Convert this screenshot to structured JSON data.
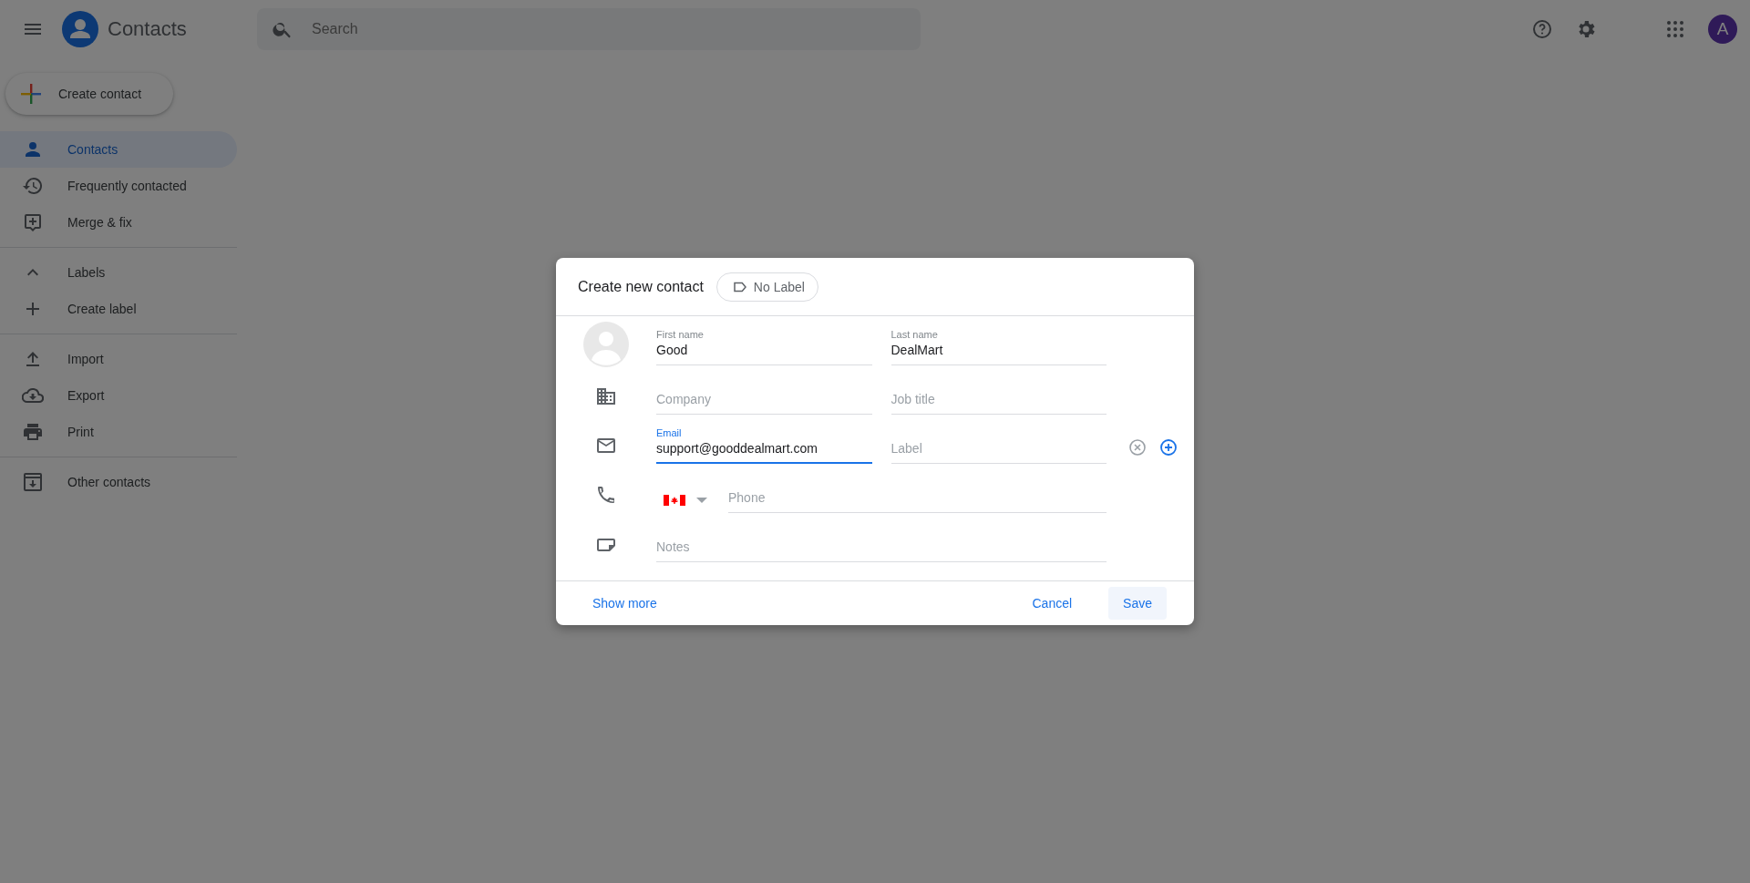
{
  "app": {
    "title": "Contacts"
  },
  "search": {
    "placeholder": "Search"
  },
  "account": {
    "initial": "A"
  },
  "create_button": {
    "label": "Create contact"
  },
  "sidebar": {
    "sections": [
      {
        "items": [
          {
            "label": "Contacts",
            "selected": true
          },
          {
            "label": "Frequently contacted",
            "selected": false
          },
          {
            "label": "Merge & fix",
            "selected": false
          }
        ]
      },
      {
        "header": {
          "label": "Labels",
          "expanded": true
        },
        "items": [
          {
            "label": "Create label",
            "selected": false
          }
        ]
      },
      {
        "items": [
          {
            "label": "Import",
            "selected": false
          },
          {
            "label": "Export",
            "selected": false
          },
          {
            "label": "Print",
            "selected": false
          }
        ]
      },
      {
        "items": [
          {
            "label": "Other contacts",
            "selected": false
          }
        ]
      }
    ]
  },
  "dialog": {
    "title": "Create new contact",
    "label_chip": "No Label",
    "rows": [
      {
        "kind": "avatar",
        "fields": [
          {
            "label": "First name",
            "value": "Good",
            "focused": false
          },
          {
            "label": "Last name",
            "value": "DealMart",
            "focused": false
          }
        ]
      },
      {
        "kind": "plain",
        "fields": [
          {
            "placeholder": "Company",
            "focused": false
          },
          {
            "placeholder": "Job title",
            "focused": false
          }
        ]
      },
      {
        "kind": "plain",
        "removable": true,
        "addable": true,
        "fields": [
          {
            "label": "Email",
            "value": "support@gooddealmart.com",
            "focused": true
          },
          {
            "placeholder": "Label",
            "focused": false
          }
        ]
      },
      {
        "kind": "phone",
        "fields": [
          {
            "placeholder": "Phone",
            "focused": false
          }
        ]
      },
      {
        "kind": "plain",
        "fields": [
          {
            "placeholder": "Notes",
            "focused": false
          }
        ]
      }
    ],
    "footer": {
      "link": "Show more",
      "buttons": [
        {
          "label": "Cancel",
          "hovered": false
        },
        {
          "label": "Save",
          "hovered": true
        }
      ]
    }
  }
}
